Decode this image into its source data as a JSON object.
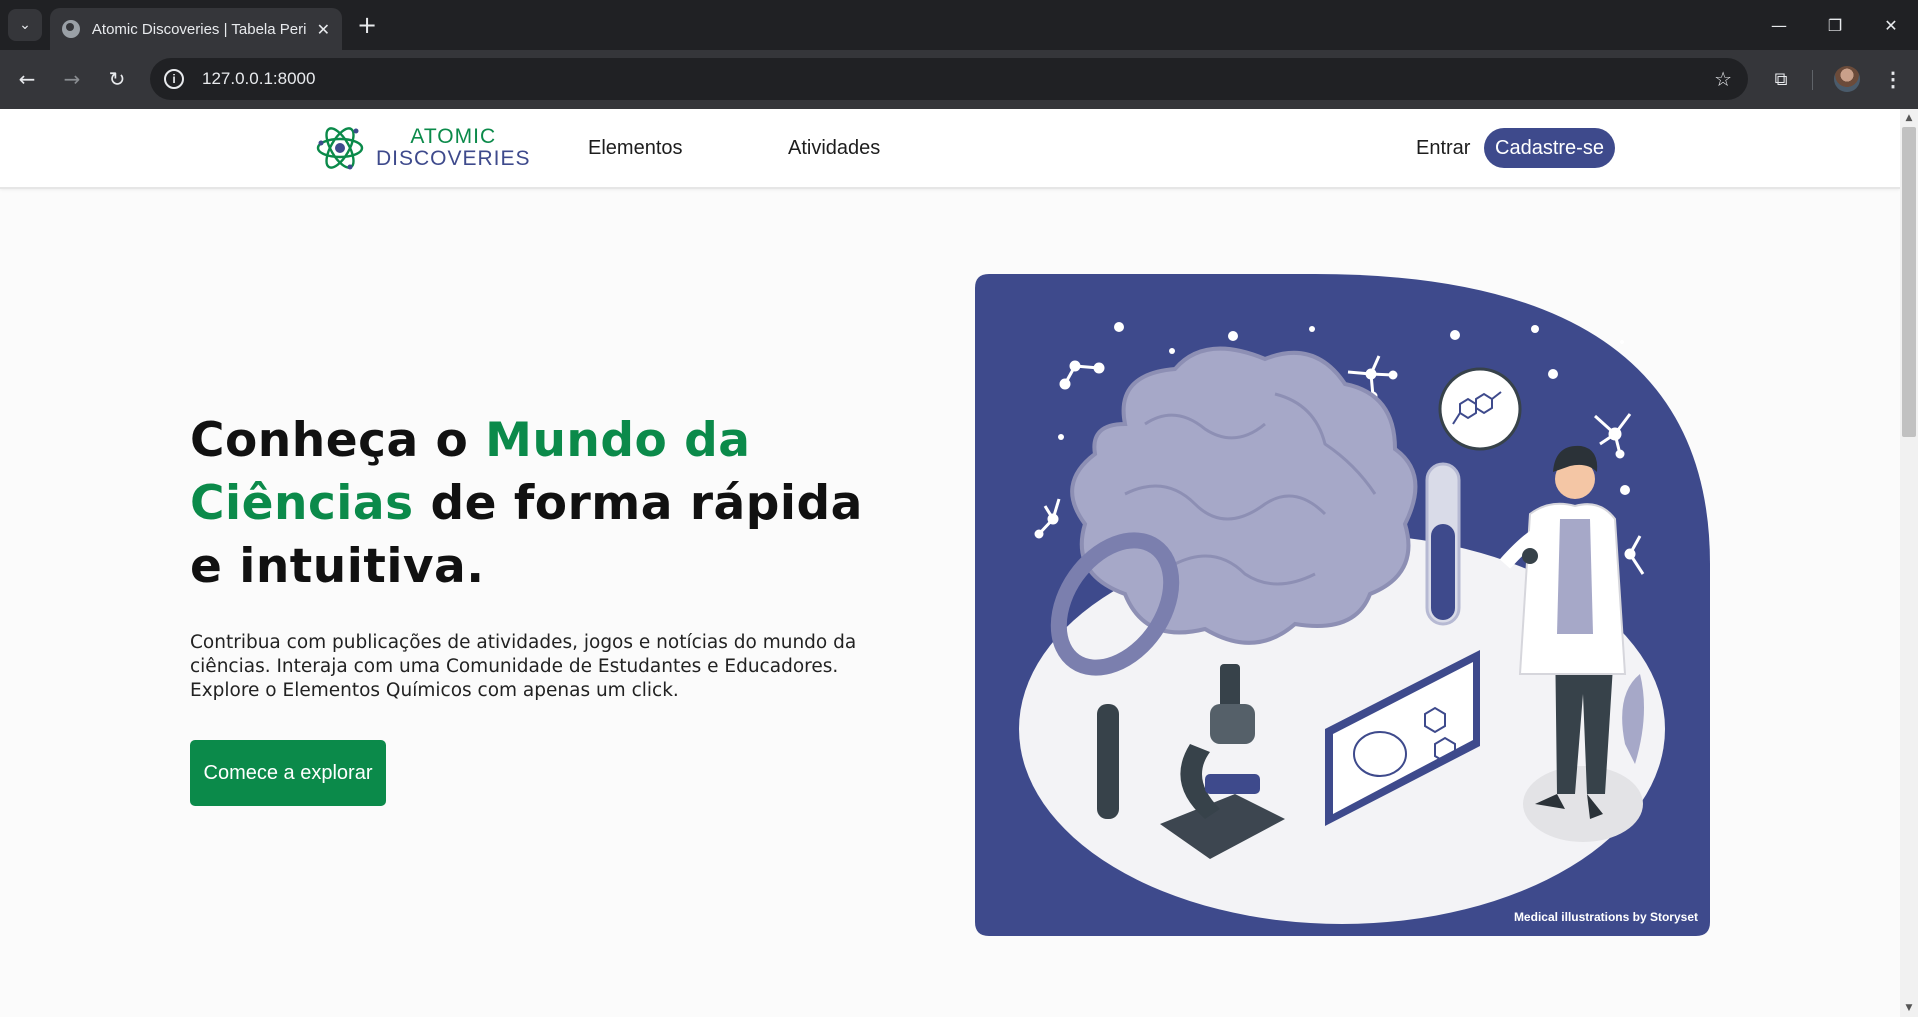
{
  "browser": {
    "tab_title": "Atomic Discoveries | Tabela Peri",
    "url": "127.0.0.1:8000"
  },
  "header": {
    "logo_line1": "ATOMIC",
    "logo_line2": "DISCOVERIES",
    "nav": [
      "Elementos",
      "Atividades"
    ],
    "login": "Entrar",
    "signup": "Cadastre-se"
  },
  "hero": {
    "title_part1": "Conheça o ",
    "title_accent": "Mundo da Ciências",
    "title_part2": " de forma rápida e intuitiva.",
    "description": "Contribua com publicações de atividades, jogos e notícias do mundo da ciências. Interaja com uma Comunidade de Estudantes e Educadores. Explore o Elementos Químicos com apenas um click.",
    "cta": "Comece a explorar"
  },
  "illustration": {
    "credit": "Medical illustrations by Storyset"
  },
  "colors": {
    "brand_green": "#0b8a4a",
    "brand_indigo": "#3e4a8c"
  }
}
